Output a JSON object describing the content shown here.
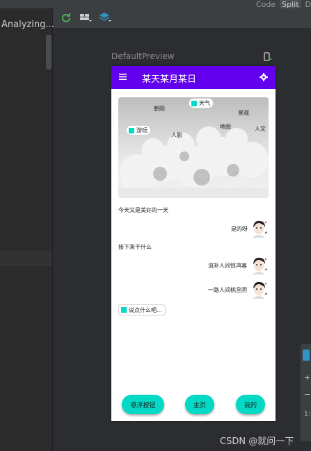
{
  "ide": {
    "analyzing_text": "Analyzing...",
    "tab_code": "Code",
    "tab_split": "Split",
    "tab_design": "D",
    "preview_name": "DefaultPreview",
    "watermark": "CSDN @就问一下"
  },
  "app": {
    "title": "某天某月某日",
    "accent": "#6200ee",
    "secondary": "#03dac5"
  },
  "hero": {
    "labels": [
      {
        "text": "朝阳"
      },
      {
        "text": "景观"
      },
      {
        "text": "地图"
      },
      {
        "text": "人文"
      },
      {
        "text": "人影"
      }
    ],
    "chip_weather": "天气",
    "chip_travel": "游玩"
  },
  "chat": {
    "m1": "今天又是美好的一天",
    "r1": "是的呀",
    "m2": "接下来干什么",
    "r2": "流补人间惊鸿客",
    "r3": "一路人间桃旦阴",
    "input_placeholder": "说点什么吧..."
  },
  "buttons": {
    "left": "悬浮按钮",
    "middle": "主页",
    "right": "我的"
  },
  "gutter": {
    "plus": "+",
    "minus": "−",
    "num": "1:"
  }
}
